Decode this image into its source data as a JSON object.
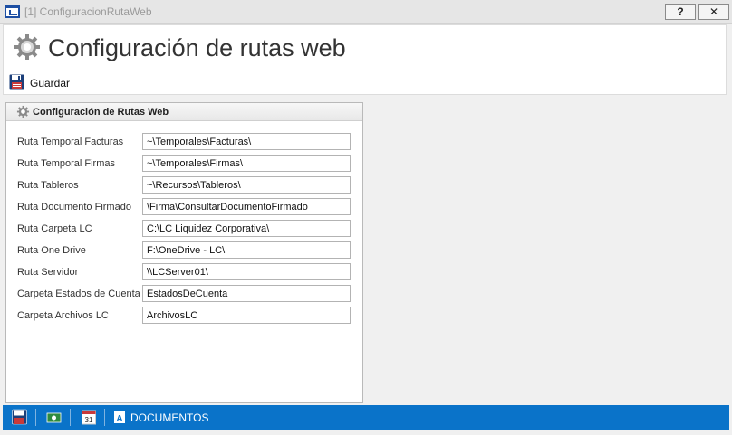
{
  "window": {
    "title": "[1] ConfiguracionRutaWeb",
    "help_label": "?",
    "close_label": "✕"
  },
  "header": {
    "title": "Configuración de rutas web",
    "save_label": "Guardar"
  },
  "group": {
    "title": "Configuración de Rutas Web",
    "fields": [
      {
        "label": "Ruta Temporal Facturas",
        "value": "~\\Temporales\\Facturas\\"
      },
      {
        "label": "Ruta Temporal Firmas",
        "value": "~\\Temporales\\Firmas\\"
      },
      {
        "label": "Ruta Tableros",
        "value": "~\\Recursos\\Tableros\\"
      },
      {
        "label": "Ruta Documento Firmado",
        "value": "\\Firma\\ConsultarDocumentoFirmado"
      },
      {
        "label": "Ruta Carpeta LC",
        "value": "C:\\LC Liquidez Corporativa\\"
      },
      {
        "label": "Ruta One Drive",
        "value": "F:\\OneDrive - LC\\"
      },
      {
        "label": "Ruta Servidor",
        "value": "\\\\LCServer01\\"
      },
      {
        "label": "Carpeta Estados de Cuenta",
        "value": "EstadosDeCuenta"
      },
      {
        "label": "Carpeta Archivos LC",
        "value": "ArchivosLC"
      }
    ]
  },
  "taskbar": {
    "calendar_day": "31",
    "documents_label": "DOCUMENTOS"
  },
  "colors": {
    "taskbar": "#0a73c9",
    "accent": "#1e4fa3"
  }
}
